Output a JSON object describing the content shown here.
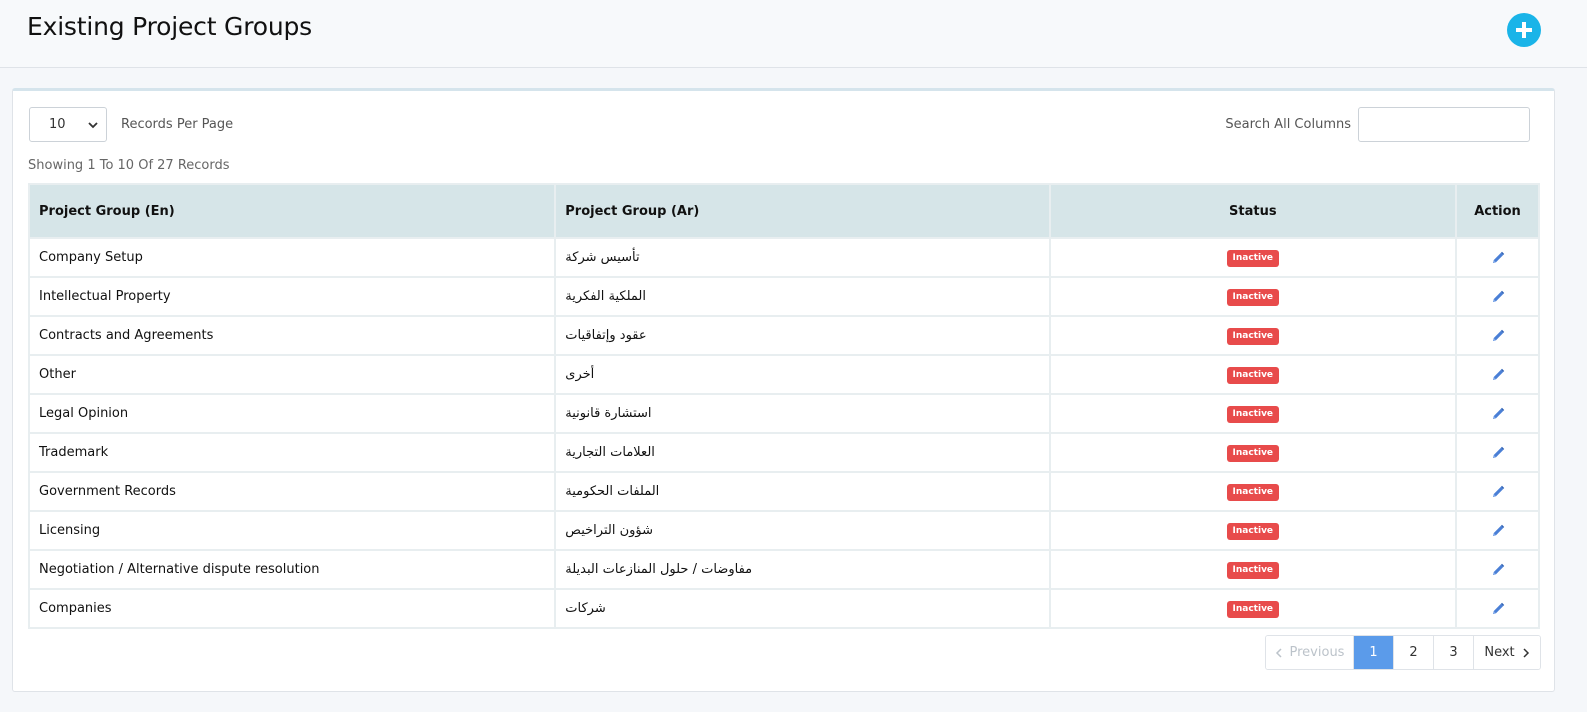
{
  "header": {
    "title": "Existing Project Groups",
    "add_icon": "plus-circle-icon",
    "accent_color": "#1ab4e8"
  },
  "controls": {
    "per_page_value": "10",
    "per_page_label": "Records Per Page",
    "search_label": "Search All Columns",
    "search_value": "",
    "records_info": "Showing 1 To 10 Of 27 Records"
  },
  "table": {
    "columns": [
      "Project Group (En)",
      "Project Group (Ar)",
      "Status",
      "Action"
    ],
    "rows": [
      {
        "en": "Company Setup",
        "ar": "تأسيس شركة",
        "status": "Inactive"
      },
      {
        "en": "Intellectual Property",
        "ar": "الملكية الفكرية",
        "status": "Inactive"
      },
      {
        "en": "Contracts and Agreements",
        "ar": "عقود وإتفاقيات",
        "status": "Inactive"
      },
      {
        "en": "Other",
        "ar": "أخرى",
        "status": "Inactive"
      },
      {
        "en": "Legal Opinion",
        "ar": "استشارة قانونية",
        "status": "Inactive"
      },
      {
        "en": "Trademark",
        "ar": "العلامات التجارية",
        "status": "Inactive"
      },
      {
        "en": "Government Records",
        "ar": "الملفات الحكومية",
        "status": "Inactive"
      },
      {
        "en": "Licensing",
        "ar": "شؤون التراخيص",
        "status": "Inactive"
      },
      {
        "en": "Negotiation / Alternative dispute resolution",
        "ar": "مفاوضات / حلول المنازعات البديلة",
        "status": "Inactive"
      },
      {
        "en": "Companies",
        "ar": "شركات",
        "status": "Inactive"
      }
    ],
    "action_icon": "pencil-edit-icon",
    "status_color": "#e84b4b",
    "header_bg": "#d6e5e8"
  },
  "pagination": {
    "previous_label": "Previous",
    "pages": [
      "1",
      "2",
      "3"
    ],
    "active_page": "1",
    "next_label": "Next",
    "active_color": "#5b9bea"
  }
}
